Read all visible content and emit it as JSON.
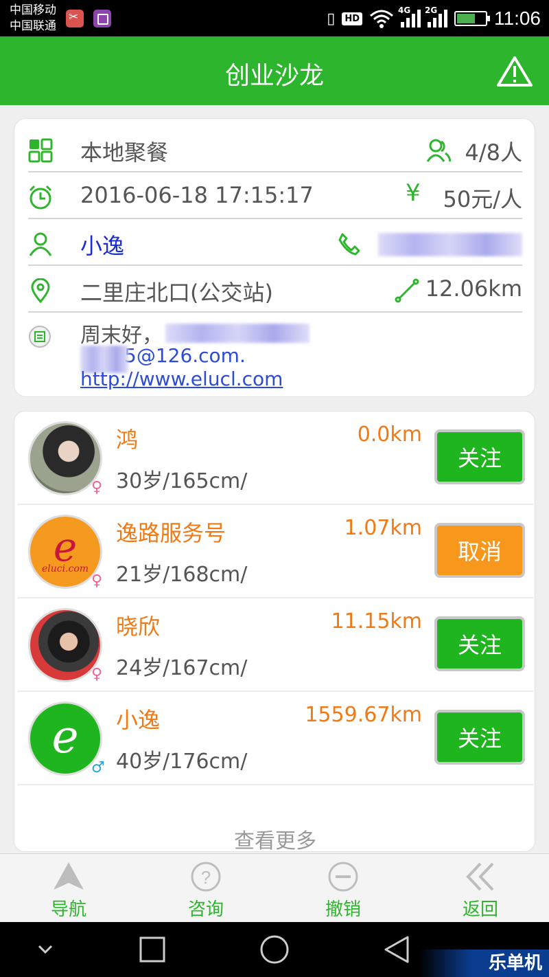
{
  "status_bar": {
    "carrier1": "中国移动",
    "carrier2": "中国联通",
    "hd": "HD",
    "net1": "4G",
    "net2": "2G",
    "time": "11:06"
  },
  "header": {
    "title": "创业沙龙",
    "warning_icon": "warning-icon"
  },
  "event": {
    "type": "本地聚餐",
    "participants": "4/8人",
    "datetime": "2016-06-18 17:15:17",
    "price": "50元/人",
    "price_symbol": "¥",
    "organizer": "小逸",
    "location": "二里庄北口(公交站)",
    "distance": "12.06km",
    "note_line1": "周末好，",
    "note_email": "5@126.com.",
    "note_url": "http://www.elucl.com"
  },
  "members": [
    {
      "name": "鸿",
      "distance": "0.0km",
      "info": "30岁/165cm/",
      "gender": "♀",
      "gender_type": "female",
      "button": "关注",
      "button_color": "#1fb51f"
    },
    {
      "name": "逸路服务号",
      "distance": "1.07km",
      "info": "21岁/168cm/",
      "gender": "♀",
      "gender_type": "female",
      "button": "取消",
      "button_color": "#f7981d",
      "avatar_text": "eluci.com"
    },
    {
      "name": "晓欣",
      "distance": "11.15km",
      "info": "24岁/167cm/",
      "gender": "♀",
      "gender_type": "female",
      "button": "关注",
      "button_color": "#1fb51f"
    },
    {
      "name": "小逸",
      "distance": "1559.67km",
      "info": "40岁/176cm/",
      "gender": "♂",
      "gender_type": "male",
      "button": "关注",
      "button_color": "#1fb51f"
    }
  ],
  "list_more": "查看更多",
  "bottom_nav": [
    {
      "label": "导航",
      "icon": "navigation-arrow-icon"
    },
    {
      "label": "咨询",
      "icon": "question-icon"
    },
    {
      "label": "撤销",
      "icon": "minus-circle-icon"
    },
    {
      "label": "返回",
      "icon": "double-chevron-left-icon"
    }
  ],
  "watermark": "乐单机",
  "colors": {
    "primary_green": "#2db52d",
    "accent_orange": "#f07a15",
    "link_blue": "#2b4bd8"
  }
}
